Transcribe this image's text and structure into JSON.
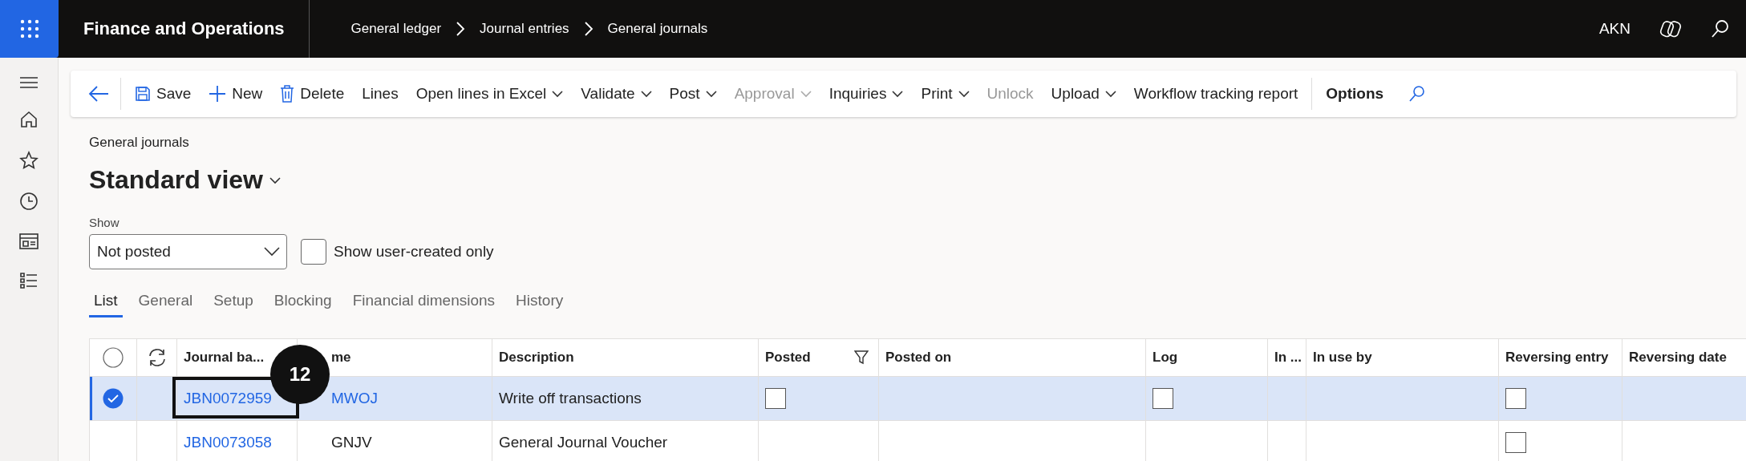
{
  "app": {
    "title": "Finance and Operations",
    "breadcrumbs": [
      "General ledger",
      "Journal entries",
      "General journals"
    ],
    "user": "AKN"
  },
  "toolbar": [
    {
      "kind": "back"
    },
    {
      "kind": "save",
      "label": "Save"
    },
    {
      "kind": "new",
      "label": "New"
    },
    {
      "kind": "delete",
      "label": "Delete"
    },
    {
      "kind": "plain",
      "label": "Lines"
    },
    {
      "kind": "plain",
      "label": "Open lines in Excel",
      "dropdown": true
    },
    {
      "kind": "plain",
      "label": "Validate",
      "dropdown": true
    },
    {
      "kind": "plain",
      "label": "Post",
      "dropdown": true
    },
    {
      "kind": "plain",
      "label": "Approval",
      "dropdown": true,
      "disabled": true
    },
    {
      "kind": "plain",
      "label": "Inquiries",
      "dropdown": true
    },
    {
      "kind": "plain",
      "label": "Print",
      "dropdown": true
    },
    {
      "kind": "plain",
      "label": "Unlock",
      "disabled": true
    },
    {
      "kind": "plain",
      "label": "Upload",
      "dropdown": true
    },
    {
      "kind": "plain",
      "label": "Workflow tracking report"
    },
    {
      "kind": "options",
      "label": "Options"
    },
    {
      "kind": "search"
    }
  ],
  "page": {
    "caption": "General journals",
    "view": "Standard view"
  },
  "filter": {
    "label": "Show",
    "value": "Not posted",
    "checkbox_label": "Show user-created only",
    "checked": false
  },
  "tabs": [
    {
      "label": "List",
      "selected": true
    },
    {
      "label": "General",
      "selected": false
    },
    {
      "label": "Setup",
      "selected": false
    },
    {
      "label": "Blocking",
      "selected": false
    },
    {
      "label": "Financial dimensions",
      "selected": false
    },
    {
      "label": "History",
      "selected": false
    }
  ],
  "table": {
    "select_all": {
      "checked": false
    },
    "columns": [
      {
        "kind": "select"
      },
      {
        "kind": "refresh"
      },
      {
        "kind": "text",
        "label": "Journal ba..."
      },
      {
        "kind": "text",
        "label": "me"
      },
      {
        "kind": "text",
        "label": "Description"
      },
      {
        "kind": "filter",
        "label": "Posted"
      },
      {
        "kind": "text",
        "label": "Posted on"
      },
      {
        "kind": "text",
        "label": "Log"
      },
      {
        "kind": "text",
        "label": "In ..."
      },
      {
        "kind": "text",
        "label": "In use by"
      },
      {
        "kind": "text",
        "label": "Reversing entry"
      },
      {
        "kind": "text",
        "label": "Reversing date"
      }
    ],
    "rows": [
      {
        "selected": true,
        "cells": [
          {
            "kind": "empty"
          },
          {
            "kind": "empty"
          },
          {
            "kind": "link",
            "text": "JBN0072959"
          },
          {
            "kind": "link",
            "text": "MWOJ"
          },
          {
            "kind": "text",
            "text": "Write off transactions"
          },
          {
            "kind": "checkbox",
            "checked": false
          },
          {
            "kind": "empty"
          },
          {
            "kind": "checkbox",
            "checked": false
          },
          {
            "kind": "empty"
          },
          {
            "kind": "empty"
          },
          {
            "kind": "checkbox",
            "checked": false
          },
          {
            "kind": "empty"
          }
        ]
      },
      {
        "selected": false,
        "cells": [
          {
            "kind": "empty"
          },
          {
            "kind": "empty"
          },
          {
            "kind": "link",
            "text": "JBN0073058"
          },
          {
            "kind": "text",
            "text": "GNJV"
          },
          {
            "kind": "text",
            "text": "General Journal Voucher"
          },
          {
            "kind": "empty"
          },
          {
            "kind": "empty"
          },
          {
            "kind": "empty"
          },
          {
            "kind": "empty"
          },
          {
            "kind": "empty"
          },
          {
            "kind": "checkbox",
            "checked": false
          },
          {
            "kind": "empty"
          }
        ]
      }
    ],
    "callout": {
      "label": "12"
    }
  }
}
